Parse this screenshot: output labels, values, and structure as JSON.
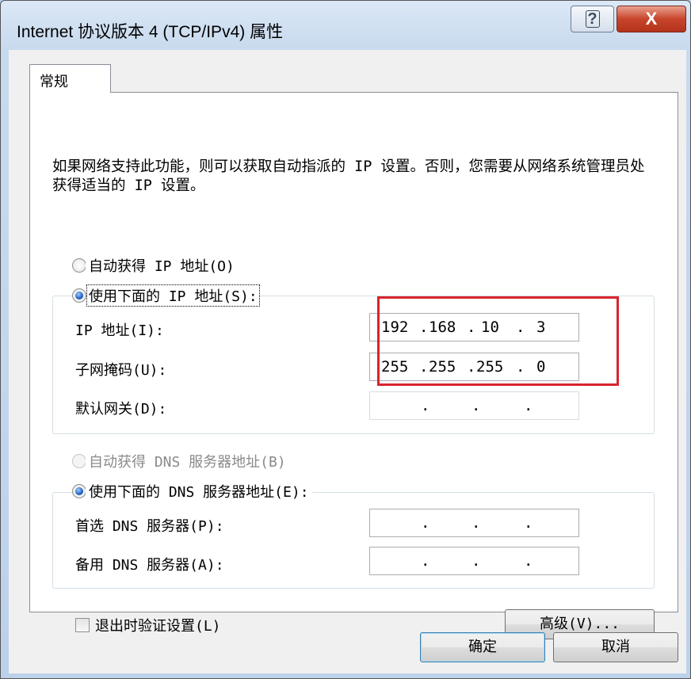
{
  "window": {
    "title": "Internet 协议版本 4 (TCP/IPv4) 属性",
    "help_glyph": "?",
    "close_glyph": "X"
  },
  "tabs": [
    {
      "label": "常规"
    }
  ],
  "description": "如果网络支持此功能，则可以获取自动指派的 IP 设置。否则，您需要从网络系统管理员处获得适当的 IP 设置。",
  "ip_settings": {
    "auto_label": "自动获得 IP 地址(O)",
    "manual_label": "使用下面的 IP 地址(S):",
    "selected": "manual",
    "fields": [
      {
        "label": "IP 地址(I):",
        "octets": [
          "192",
          "168",
          "10",
          "3"
        ]
      },
      {
        "label": "子网掩码(U):",
        "octets": [
          "255",
          "255",
          "255",
          "0"
        ]
      },
      {
        "label": "默认网关(D):",
        "octets": [
          "",
          "",
          "",
          ""
        ]
      }
    ]
  },
  "dns_settings": {
    "auto_label": "自动获得 DNS 服务器地址(B)",
    "manual_label": "使用下面的 DNS 服务器地址(E):",
    "selected": "manual",
    "fields": [
      {
        "label": "首选 DNS 服务器(P):",
        "octets": [
          "",
          "",
          "",
          ""
        ]
      },
      {
        "label": "备用 DNS 服务器(A):",
        "octets": [
          "",
          "",
          "",
          ""
        ]
      }
    ]
  },
  "validate_checkbox": {
    "label": "退出时验证设置(L)",
    "checked": false
  },
  "buttons": {
    "advanced": "高级(V)...",
    "ok": "确定",
    "cancel": "取消"
  },
  "ip_dot": ".",
  "highlight_color": "#d9232d"
}
